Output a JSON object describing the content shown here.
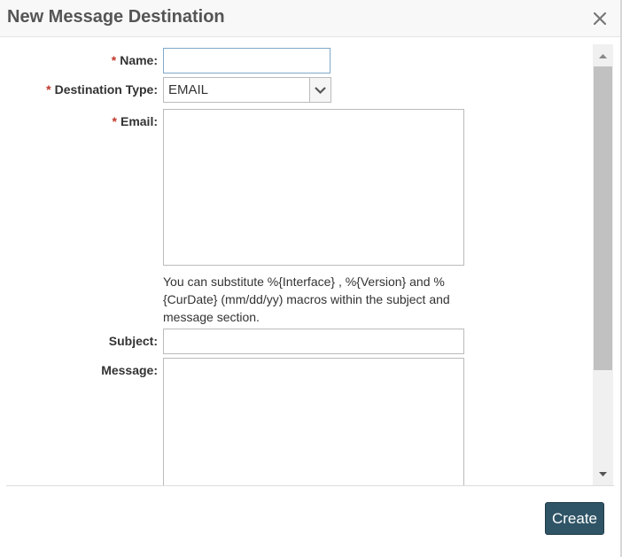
{
  "dialog": {
    "title": "New Message Destination",
    "close_icon": "close-icon"
  },
  "form": {
    "required_marker": "*",
    "name": {
      "label": "Name:",
      "value": "",
      "required": true
    },
    "destination_type": {
      "label": "Destination Type:",
      "selected": "EMAIL",
      "required": true,
      "icon": "chevron-down-icon"
    },
    "email": {
      "label": "Email:",
      "value": "",
      "required": true
    },
    "hint": "You can substitute %{Interface} , %{Version} and %{CurDate} (mm/dd/yy) macros within the subject and message section.",
    "subject": {
      "label": "Subject:",
      "value": ""
    },
    "message": {
      "label": "Message:",
      "value": ""
    }
  },
  "footer": {
    "create_label": "Create"
  },
  "colors": {
    "accent_button": "#2f5466",
    "required": "#c0392b",
    "focused_border": "#7fa7c9"
  }
}
